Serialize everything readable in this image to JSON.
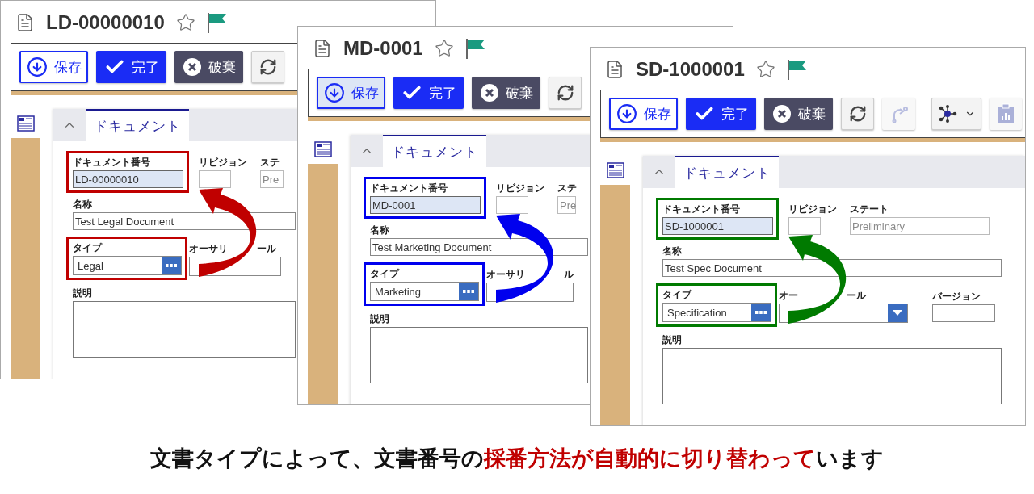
{
  "windows": [
    {
      "title": "LD-00000010",
      "color": "#c00000",
      "buttons": [
        {
          "kind": "save",
          "label": "保存",
          "pressed": false
        },
        {
          "kind": "complete",
          "label": "完了",
          "pressed": false
        },
        {
          "kind": "discard",
          "label": "破棄",
          "pressed": false
        },
        {
          "kind": "refresh",
          "pressed": false
        }
      ],
      "tab": "ドキュメント",
      "fields": {
        "number": {
          "label": "ドキュメント番号",
          "value": "LD-00000010"
        },
        "revision": {
          "label": "リビジョン"
        },
        "state": {
          "label": "ステ",
          "value": "Pre"
        },
        "name": {
          "label": "名称",
          "value": "Test Legal Document"
        },
        "type": {
          "label": "タイプ",
          "value": "Legal"
        },
        "authoring": {
          "label_start": "オーサリ",
          "label_end": "ール"
        },
        "description": {
          "label": "説明"
        }
      }
    },
    {
      "title": "MD-0001",
      "color": "#0000ee",
      "buttons": [
        {
          "kind": "save",
          "label": "保存",
          "pressed": true
        },
        {
          "kind": "complete",
          "label": "完了",
          "pressed": false
        },
        {
          "kind": "discard",
          "label": "破棄",
          "pressed": false
        },
        {
          "kind": "refresh",
          "pressed": false
        }
      ],
      "tab": "ドキュメント",
      "fields": {
        "number": {
          "label": "ドキュメント番号",
          "value": "MD-0001"
        },
        "revision": {
          "label": "リビジョン"
        },
        "state": {
          "label": "ステ",
          "value": "Pre"
        },
        "name": {
          "label": "名称",
          "value": "Test Marketing Document"
        },
        "type": {
          "label": "タイプ",
          "value": "Marketing"
        },
        "authoring": {
          "label_start": "オーサリ",
          "label_end": "ル"
        },
        "description": {
          "label": "説明"
        }
      }
    },
    {
      "title": "SD-1000001",
      "color": "#007a00",
      "buttons": [
        {
          "kind": "save",
          "label": "保存",
          "pressed": false
        },
        {
          "kind": "complete",
          "label": "完了",
          "pressed": false
        },
        {
          "kind": "discard",
          "label": "破棄",
          "pressed": false
        },
        {
          "kind": "refresh",
          "pressed": false
        },
        {
          "kind": "route",
          "pressed": false
        },
        {
          "kind": "separator"
        },
        {
          "kind": "network",
          "pressed": false
        },
        {
          "kind": "report",
          "pressed": false
        }
      ],
      "tab": "ドキュメント",
      "fields": {
        "number": {
          "label": "ドキュメント番号",
          "value": "SD-1000001"
        },
        "revision": {
          "label": "リビジョン"
        },
        "state": {
          "label": "ステート",
          "value": "Preliminary"
        },
        "name": {
          "label": "名称",
          "value": "Test Spec Document"
        },
        "type": {
          "label": "タイプ",
          "value": "Specification"
        },
        "authoring": {
          "label_start": "オー",
          "label_end": "ール",
          "dropdown": true
        },
        "version": {
          "label": "バージョン"
        },
        "description": {
          "label": "説明"
        }
      }
    }
  ],
  "caption": [
    {
      "text": "文書タイプによって、文書番号の",
      "emphasis": false
    },
    {
      "text": "採番方法が自動的に切り替わって",
      "emphasis": true
    },
    {
      "text": "います",
      "emphasis": false
    }
  ]
}
